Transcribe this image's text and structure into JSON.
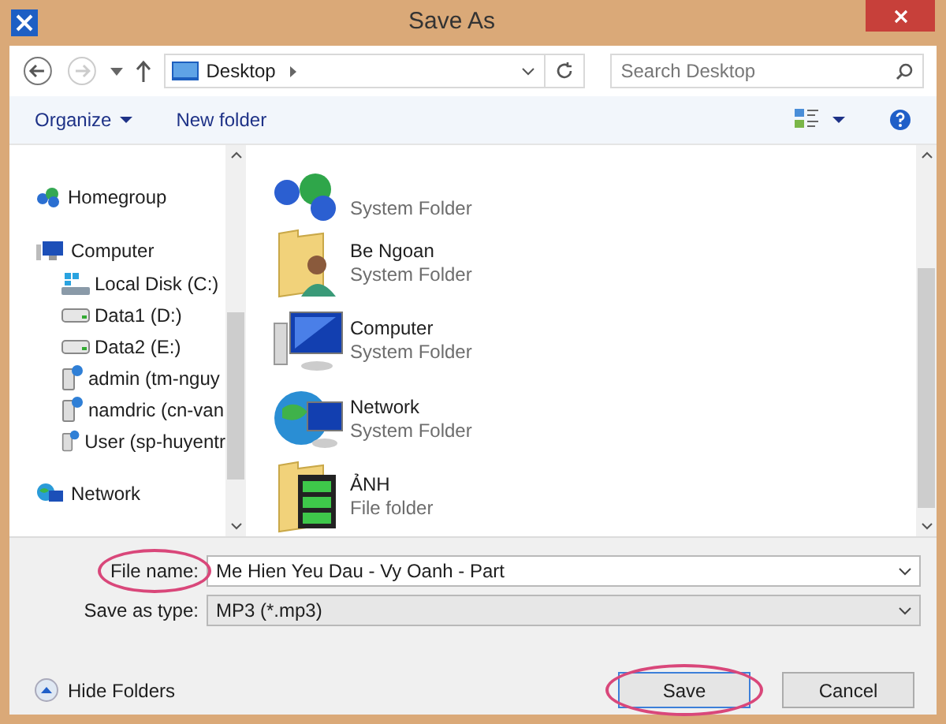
{
  "window": {
    "title": "Save As"
  },
  "address_bar": {
    "location": "Desktop"
  },
  "search": {
    "placeholder": "Search Desktop"
  },
  "toolbar": {
    "organize": "Organize",
    "new_folder": "New folder"
  },
  "sidebar": {
    "items": [
      {
        "label": "Homegroup",
        "kind": "homegroup"
      },
      {
        "label": "Computer",
        "kind": "computer",
        "children": [
          {
            "label": "Local Disk (C:)",
            "kind": "system-drive"
          },
          {
            "label": "Data1 (D:)",
            "kind": "drive"
          },
          {
            "label": "Data2 (E:)",
            "kind": "drive"
          },
          {
            "label": "admin (tm-nguy",
            "kind": "network-drive"
          },
          {
            "label": "namdric (cn-van",
            "kind": "network-drive"
          },
          {
            "label": "User (sp-huyentr",
            "kind": "network-drive"
          }
        ]
      },
      {
        "label": "Network",
        "kind": "network"
      }
    ]
  },
  "files": [
    {
      "kind": "homegroup",
      "type": "System Folder"
    },
    {
      "kind": "user-folder",
      "name": "Be Ngoan",
      "type": "System Folder"
    },
    {
      "kind": "computer",
      "name": "Computer",
      "type": "System Folder"
    },
    {
      "kind": "network",
      "name": "Network",
      "type": "System Folder"
    },
    {
      "kind": "picture-folder",
      "name": "ẢNH",
      "type": "File folder"
    }
  ],
  "form": [
    {
      "label": "File name:",
      "value": "Me Hien Yeu Dau - Vy Oanh - Part",
      "circled": true,
      "editable": true
    },
    {
      "label": "Save as type:",
      "value": "MP3 (*.mp3)",
      "circled": false,
      "editable": false
    }
  ],
  "hide_folders": "Hide Folders",
  "buttons": [
    {
      "label": "Save",
      "default": true,
      "circled": true
    },
    {
      "label": "Cancel",
      "default": false,
      "circled": false
    }
  ]
}
